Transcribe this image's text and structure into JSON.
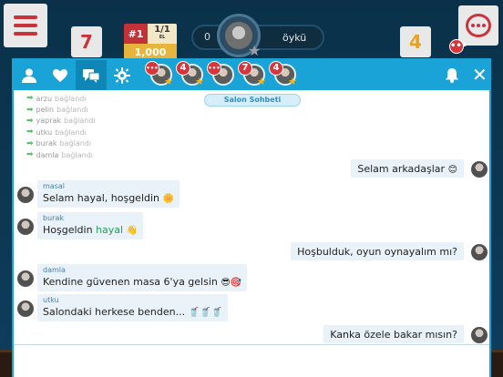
{
  "topbar": {
    "card_left": "7",
    "card_right": "4",
    "rank": {
      "position": "#1",
      "ratio": "1/1",
      "ratio_sub": "EL",
      "score": "1,000"
    },
    "player": {
      "number": "0",
      "name": "öykü"
    },
    "chat_badge": "•••"
  },
  "tabs": {
    "avatar_badges": [
      "•••",
      "4",
      "•••",
      "7",
      "4"
    ]
  },
  "chat": {
    "room_label": "Salon Sohbeti",
    "joins": [
      {
        "user": "arzu",
        "action": "bağlandı"
      },
      {
        "user": "pelin",
        "action": "bağlandı"
      },
      {
        "user": "yaprak",
        "action": "bağlandı"
      },
      {
        "user": "utku",
        "action": "bağlandı"
      },
      {
        "user": "burak",
        "action": "bağlandı"
      },
      {
        "user": "damla",
        "action": "bağlandı"
      }
    ],
    "messages": [
      {
        "side": "right",
        "text": "Selam arkadaşlar",
        "emoji": "😊"
      },
      {
        "side": "left",
        "user": "masal",
        "text": "Selam hayal, hoşgeldin",
        "emoji": "🌼"
      },
      {
        "side": "left",
        "user": "burak",
        "text_pre": "Hoşgeldin",
        "text_highlight": "hayal",
        "emoji": "👋"
      },
      {
        "side": "right",
        "text": "Hoşbulduk, oyun oynayalım mı?"
      },
      {
        "side": "left",
        "user": "damla",
        "text": "Kendine güvenen masa 6'ya gelsin",
        "emoji": "😎🎯"
      },
      {
        "side": "left",
        "user": "utku",
        "text": "Salondaki herkese benden...",
        "emoji": "🥤🥤🥤"
      },
      {
        "side": "right",
        "text": "Kanka özele bakar mısın?"
      }
    ]
  },
  "colors": {
    "accent": "#1aa3d6",
    "red": "#c8343a",
    "yellow": "#e9a21b"
  }
}
